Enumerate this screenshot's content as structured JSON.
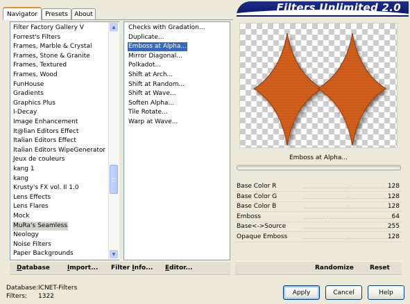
{
  "tabs": [
    {
      "label": "Navigator",
      "active": true
    },
    {
      "label": "Presets",
      "active": false
    },
    {
      "label": "About",
      "active": false
    }
  ],
  "app_title": "Filters Unlimited 2.0",
  "categories": {
    "items": [
      "Filter Factory Gallery V",
      "Forrest's Filters",
      "Frames, Marble & Crystal",
      "Frames, Stone & Granite",
      "Frames, Textured",
      "Frames, Wood",
      "FunHouse",
      "Gradients",
      "Graphics Plus",
      "I-Decay",
      "Image Enhancement",
      "It@lian Editors Effect",
      "Italian Editors Effect",
      "Italian Editors WipeGenerator",
      "Jeux de couleurs",
      "kang 1",
      "kang",
      "Krusty's FX vol. II 1.0",
      "Lens Effects",
      "Lens Flares",
      "Mock",
      "MuRa's Seamless",
      "Neology",
      "Noise Filters",
      "Paper Backgrounds"
    ],
    "selected": "MuRa's Seamless"
  },
  "filters": {
    "items": [
      "Checks with Gradation...",
      "Duplicate...",
      "Emboss at Alpha...",
      "Mirror Diagonal...",
      "Polkadot...",
      "Shift at Arch...",
      "Shift at Random...",
      "Shift at Wave...",
      "Soften Alpha...",
      "Tile Rotate...",
      "Warp at Wave..."
    ],
    "selected": "Emboss at Alpha..."
  },
  "current_filter": "Emboss at Alpha...",
  "params": [
    {
      "label": "Base Color R",
      "value": "128",
      "level": 0.5
    },
    {
      "label": "Base Color G",
      "value": "128",
      "level": 0.5
    },
    {
      "label": "Base Color B",
      "value": "128",
      "level": 0.5
    },
    {
      "label": "Emboss",
      "value": "64",
      "level": 0.25
    },
    {
      "label": "Base<->Source",
      "value": "255",
      "level": 1.0
    },
    {
      "label": "Opaque Emboss",
      "value": "128",
      "level": 0.5
    }
  ],
  "toolbar": {
    "database": "Database",
    "import": "Import...",
    "filter_info": "Filter Info...",
    "editor": "Editor...",
    "randomize": "Randomize",
    "reset": "Reset"
  },
  "info": {
    "database_label": "Database:",
    "database_value": "ICNET-Filters",
    "filters_label": "Filters:",
    "filters_value": "1322"
  },
  "buttons": {
    "apply": "Apply",
    "cancel": "Cancel",
    "help": "Help"
  },
  "colors": {
    "accent": "#316ac5",
    "banner": "#0a1866",
    "shape_fill": "#d2601a"
  },
  "icons": {
    "scroll_up": "scroll-up-arrow-icon",
    "scroll_down": "scroll-down-arrow-icon"
  }
}
